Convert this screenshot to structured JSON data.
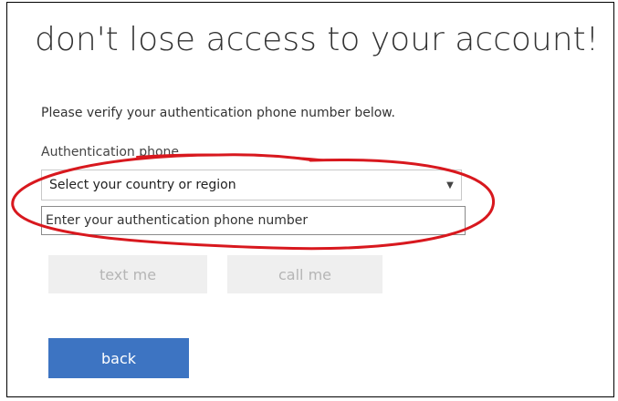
{
  "page": {
    "title": "don't lose access to your account!",
    "instruction": "Please verify your authentication phone number below."
  },
  "form": {
    "phone_label": "Authentication phone",
    "country_select": {
      "selected": "Select your country or region"
    },
    "phone_input": {
      "value": "",
      "placeholder": "Enter your authentication phone number"
    }
  },
  "actions": {
    "text_me_label": "text me",
    "call_me_label": "call me",
    "back_label": "back"
  },
  "colors": {
    "primary_button": "#3d74c2",
    "disabled_button": "#efefef",
    "annotation_ellipse": "#d8181e"
  },
  "icons": {
    "select_indicator": "chevron-down-icon"
  }
}
